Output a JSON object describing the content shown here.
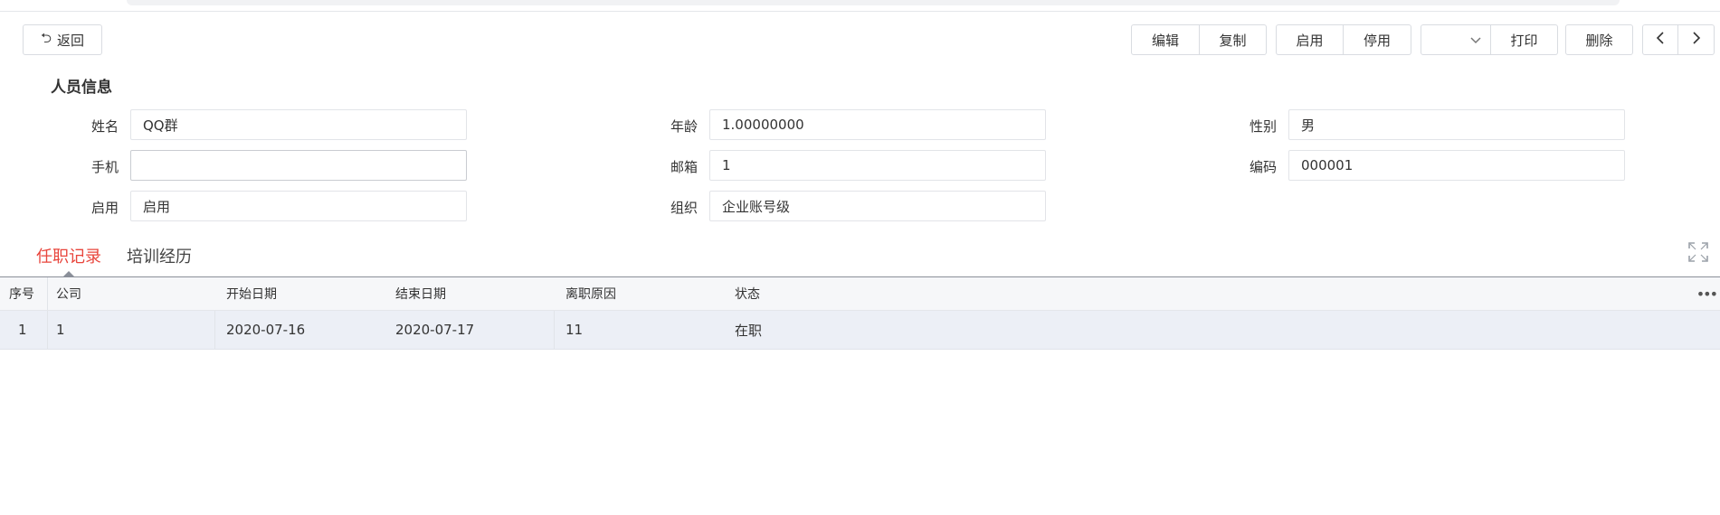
{
  "toolbar": {
    "back_label": "返回",
    "edit_label": "编辑",
    "copy_label": "复制",
    "enable_label": "启用",
    "disable_label": "停用",
    "dropdown_value": "",
    "print_label": "打印",
    "delete_label": "删除",
    "prev_symbol": "‹",
    "next_symbol": "›"
  },
  "section_title": "人员信息",
  "fields": {
    "name": {
      "label": "姓名",
      "value": "QQ群"
    },
    "age": {
      "label": "年龄",
      "value": "1.00000000"
    },
    "gender": {
      "label": "性别",
      "value": "男"
    },
    "mobile": {
      "label": "手机",
      "value": ""
    },
    "email": {
      "label": "邮箱",
      "value": "1"
    },
    "code": {
      "label": "编码",
      "value": "000001"
    },
    "enabled": {
      "label": "启用",
      "value": "启用"
    },
    "org": {
      "label": "组织",
      "value": "企业账号级"
    }
  },
  "tabs": [
    {
      "label": "任职记录",
      "active": true
    },
    {
      "label": "培训经历",
      "active": false
    }
  ],
  "grid": {
    "columns": [
      "序号",
      "公司",
      "开始日期",
      "结束日期",
      "离职原因",
      "状态"
    ],
    "rows": [
      [
        "1",
        "1",
        "2020-07-16",
        "2020-07-17",
        "11",
        "在职"
      ]
    ]
  },
  "colors": {
    "active_tab": "#e8453c",
    "row_highlight": "#eceff6",
    "border": "#d9dce1"
  },
  "icons": {
    "back": "undo-arrow-icon",
    "dropdown": "chevron-down-icon",
    "prev": "chevron-left-icon",
    "next": "chevron-right-icon",
    "expand": "fullscreen-icon",
    "more": "more-horizontal-icon"
  }
}
